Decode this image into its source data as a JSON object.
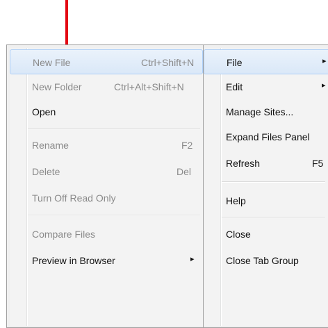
{
  "left_menu": {
    "items": [
      {
        "label": "New File",
        "shortcut": "Ctrl+Shift+N"
      },
      {
        "label": "New Folder",
        "shortcut": "Ctrl+Alt+Shift+N"
      },
      {
        "label": "Open"
      },
      {
        "label": "Rename",
        "shortcut": "F2"
      },
      {
        "label": "Delete",
        "shortcut": "Del"
      },
      {
        "label": "Turn Off Read Only"
      },
      {
        "label": "Compare Files"
      },
      {
        "label": "Preview in Browser",
        "submenu_glyph": "▸"
      }
    ]
  },
  "right_menu": {
    "items": [
      {
        "label": "File",
        "submenu_glyph": "▸"
      },
      {
        "label": "Edit",
        "submenu_glyph": "▸"
      },
      {
        "label": "Manage Sites..."
      },
      {
        "label": "Expand Files Panel"
      },
      {
        "label": "Refresh",
        "shortcut": "F5"
      },
      {
        "label": "Help"
      },
      {
        "label": "Close"
      },
      {
        "label": "Close Tab Group"
      }
    ]
  },
  "annotation": {
    "icon": "red-down-arrow-icon",
    "color": "#e30613"
  },
  "colors": {
    "disabled_text": "#8a8a8a",
    "enabled_text": "#111111",
    "hover_border": "#aecff7"
  }
}
